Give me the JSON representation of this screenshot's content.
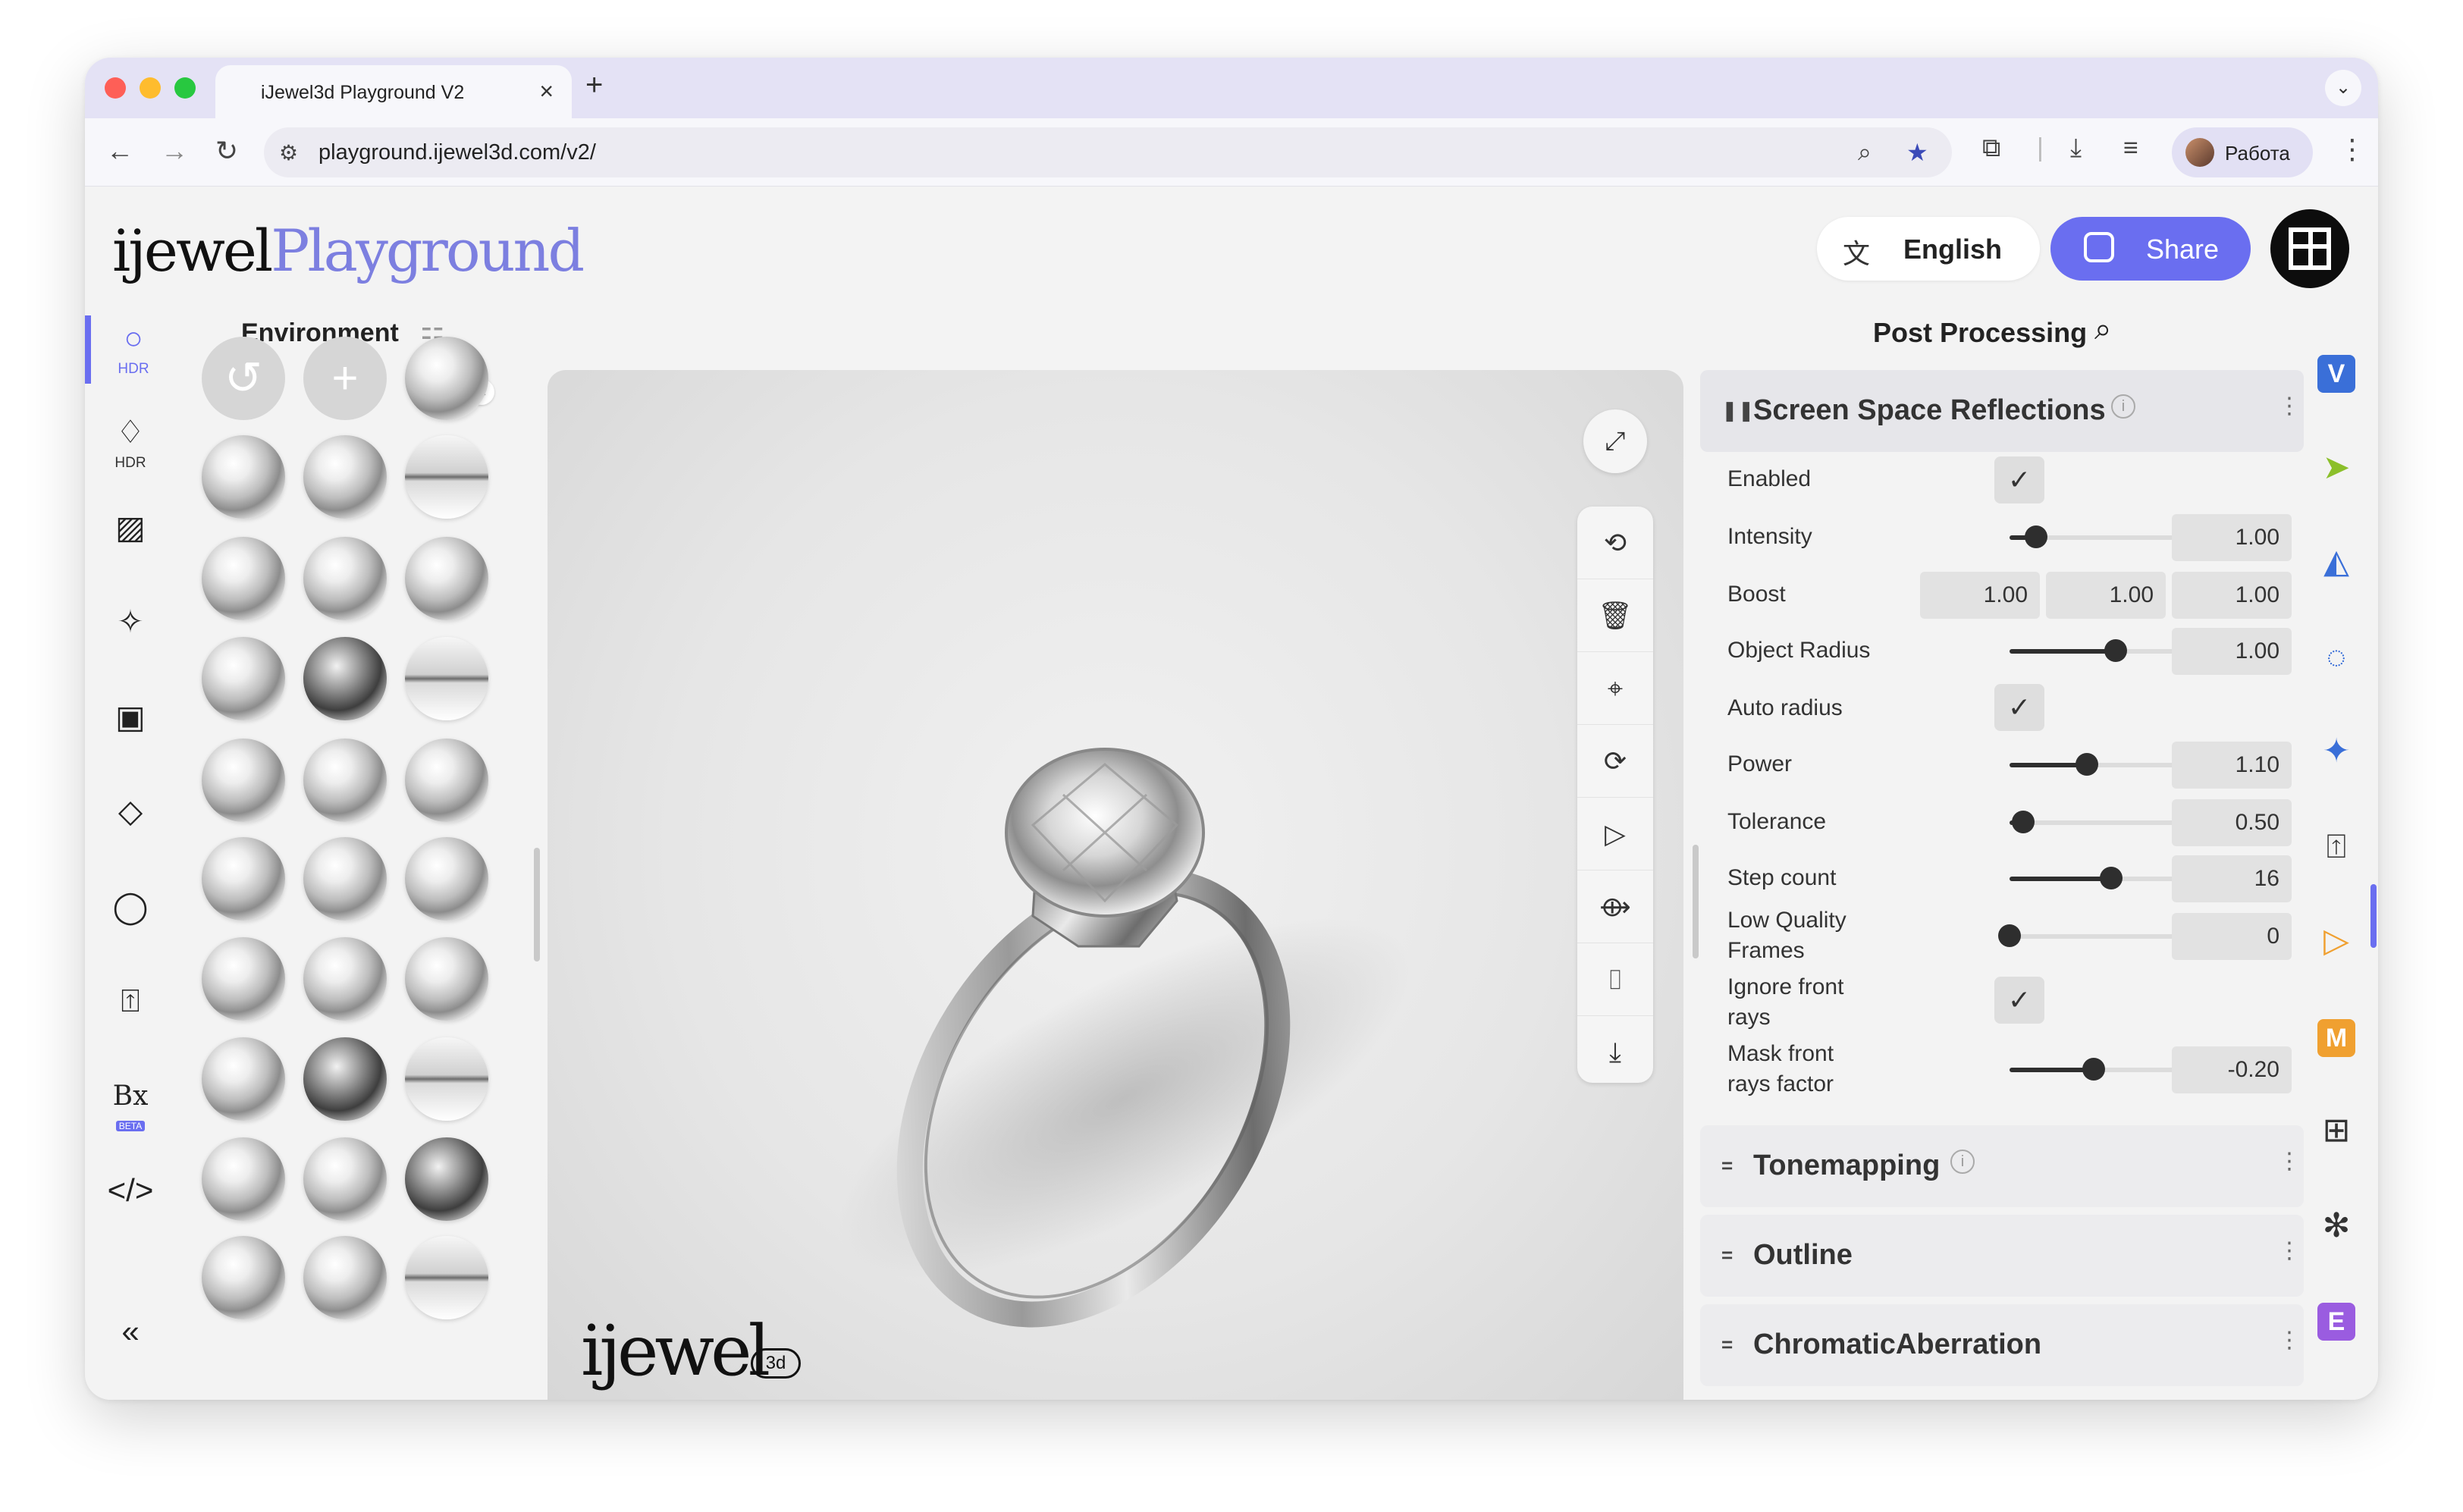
{
  "browser": {
    "tab_title": "iJewel3d Playground V2",
    "url": "playground.ijewel3d.com/v2/",
    "profile_name": "Работа"
  },
  "header": {
    "logo_dark": "ijewel",
    "logo_accent": "Playground",
    "language_label": "English",
    "share_label": "Share",
    "accent_color": "#6a6ef0"
  },
  "left_rail": {
    "items": [
      {
        "icon": "circle-icon",
        "label": "HDR",
        "active": true
      },
      {
        "icon": "diamond-icon",
        "label": "HDR"
      },
      {
        "icon": "hatch-icon",
        "label": ""
      },
      {
        "icon": "sparkle-icon",
        "label": ""
      },
      {
        "icon": "scene-icon",
        "label": ""
      },
      {
        "icon": "plane-icon",
        "label": ""
      },
      {
        "icon": "ring-icon",
        "label": ""
      },
      {
        "icon": "export-icon",
        "label": ""
      },
      {
        "icon": "bx-icon",
        "label": "BETA"
      },
      {
        "icon": "code-icon",
        "label": ""
      },
      {
        "icon": "collapse-icon",
        "label": ""
      }
    ]
  },
  "environment": {
    "title": "Environment"
  },
  "viewport": {
    "logo": "ijewel",
    "logo_badge": "3d"
  },
  "post_processing": {
    "title": "Post Processing",
    "ssr": {
      "title": "Screen Space Reflections",
      "enabled_label": "Enabled",
      "intensity_label": "Intensity",
      "intensity_value": "1.00",
      "intensity_level": 0.12,
      "boost_label": "Boost",
      "boost_values": [
        "1.00",
        "1.00",
        "1.00"
      ],
      "object_radius_label": "Object Radius",
      "object_radius_value": "1.00",
      "object_radius_level": 0.48,
      "auto_radius_label": "Auto radius",
      "power_label": "Power",
      "power_value": "1.10",
      "power_level": 0.35,
      "tolerance_label": "Tolerance",
      "tolerance_value": "0.50",
      "tolerance_level": 0.06,
      "step_count_label": "Step count",
      "step_count_value": "16",
      "step_count_level": 0.46,
      "lqf_label_1": "Low Quality",
      "lqf_label_2": "Frames",
      "lqf_value": "0",
      "lqf_level": 0.0,
      "ifr_label_1": "Ignore front",
      "ifr_label_2": "rays",
      "mfr_label_1": "Mask front",
      "mfr_label_2": "rays factor",
      "mfr_value": "-0.20",
      "mfr_level": 0.38
    },
    "tonemapping_title": "Tonemapping",
    "outline_title": "Outline",
    "chromatic_title": "ChromaticAberration"
  },
  "right_rail": {
    "badges": [
      "V",
      "M",
      "E"
    ]
  }
}
